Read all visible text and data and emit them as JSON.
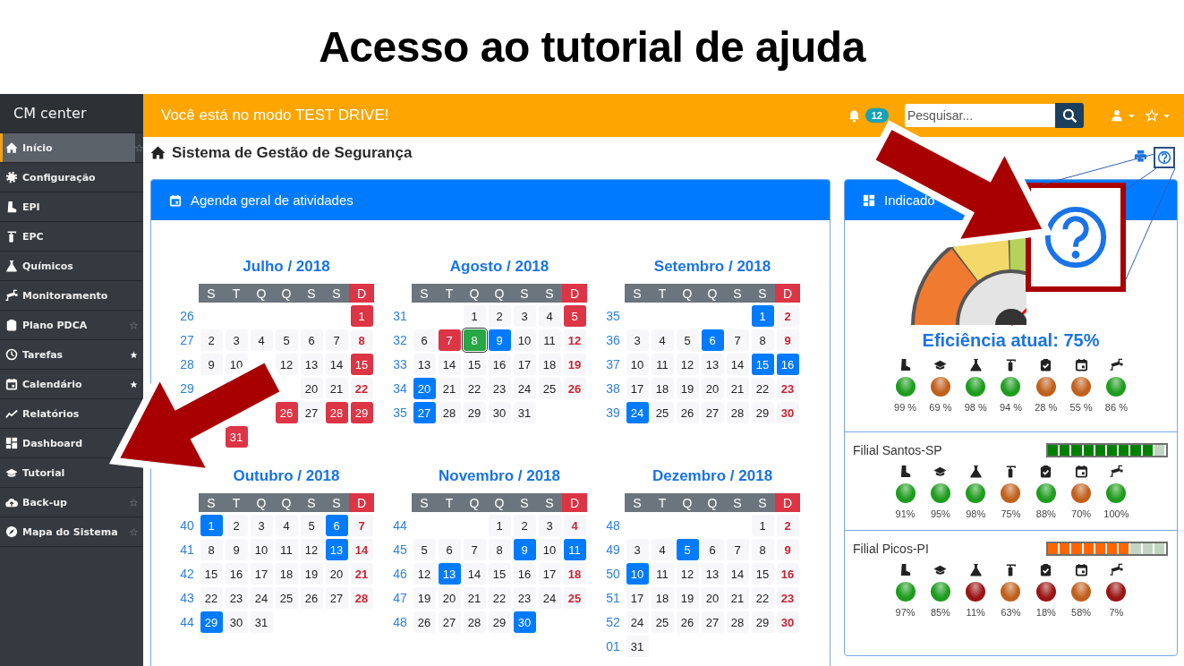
{
  "slide_title": "Acesso ao tutorial de ajuda",
  "sidebar": {
    "brand": "CM center",
    "items": [
      {
        "label": "Início",
        "selected": true,
        "starred": false
      },
      {
        "label": "Configuração",
        "selected": false
      },
      {
        "label": "EPI",
        "selected": false
      },
      {
        "label": "EPC",
        "selected": false
      },
      {
        "label": "Químicos",
        "selected": false
      },
      {
        "label": "Monitoramento",
        "selected": false
      },
      {
        "label": "Plano PDCA",
        "selected": false,
        "starred": false
      },
      {
        "label": "Tarefas",
        "selected": false,
        "starred": true
      },
      {
        "label": "Calendário",
        "selected": false,
        "starred": true
      },
      {
        "label": "Relatórios",
        "selected": false
      },
      {
        "label": "Dashboard",
        "selected": false
      },
      {
        "label": "Tutorial",
        "selected": false
      },
      {
        "label": "Back-up",
        "selected": false,
        "starred": false
      },
      {
        "label": "Mapa do Sistema",
        "selected": false,
        "starred": false
      }
    ]
  },
  "topbar": {
    "message": "Você está no modo TEST DRIVE!",
    "notifications": "12",
    "search": {
      "placeholder": "Pesquisar..."
    }
  },
  "page": {
    "title": "Sistema de Gestão de Segurança"
  },
  "agenda": {
    "title": "Agenda geral de atividades",
    "months": [
      {
        "title": "Julho / 2018",
        "weekdays": [
          "S",
          "T",
          "Q",
          "Q",
          "S",
          "S",
          "D"
        ],
        "weeks": [
          {
            "number": "26",
            "days": [
              {
                "kind": "blank"
              },
              {
                "kind": "blank"
              },
              {
                "kind": "blank"
              },
              {
                "kind": "blank"
              },
              {
                "kind": "blank"
              },
              {
                "kind": "blank"
              },
              {
                "day": "1",
                "kind": "event",
                "color": "#dc3545"
              }
            ]
          },
          {
            "number": "27",
            "days": [
              {
                "day": "2",
                "kind": "plain"
              },
              {
                "day": "3",
                "kind": "plain"
              },
              {
                "day": "4",
                "kind": "plain"
              },
              {
                "day": "5",
                "kind": "plain"
              },
              {
                "day": "6",
                "kind": "plain"
              },
              {
                "day": "7",
                "kind": "plain"
              },
              {
                "day": "8",
                "kind": "plain"
              }
            ]
          },
          {
            "number": "28",
            "days": [
              {
                "day": "9",
                "kind": "plain"
              },
              {
                "day": "10",
                "kind": "plain"
              },
              {
                "kind": "blank"
              },
              {
                "day": "12",
                "kind": "plain"
              },
              {
                "day": "13",
                "kind": "plain"
              },
              {
                "day": "14",
                "kind": "plain"
              },
              {
                "day": "15",
                "kind": "event",
                "color": "#dc3545"
              }
            ]
          },
          {
            "number": "29",
            "days": [
              {
                "kind": "blank"
              },
              {
                "kind": "blank"
              },
              {
                "kind": "blank"
              },
              {
                "kind": "blank"
              },
              {
                "day": "20",
                "kind": "plain"
              },
              {
                "day": "21",
                "kind": "plain"
              },
              {
                "day": "22",
                "kind": "plain"
              }
            ]
          },
          {
            "days": [
              {
                "kind": "blank"
              },
              {
                "kind": "blank"
              },
              {
                "kind": "blank"
              },
              {
                "day": "26",
                "kind": "event",
                "color": "#dc3545"
              },
              {
                "day": "27",
                "kind": "plain"
              },
              {
                "day": "28",
                "kind": "event",
                "color": "#dc3545"
              },
              {
                "day": "29",
                "kind": "event",
                "color": "#dc3545"
              }
            ]
          },
          {
            "days": [
              {
                "kind": "blank"
              },
              {
                "day": "31",
                "kind": "event",
                "color": "#dc3545"
              }
            ]
          }
        ]
      },
      {
        "title": "Agosto / 2018",
        "weekdays": [
          "S",
          "T",
          "Q",
          "Q",
          "S",
          "S",
          "D"
        ],
        "weeks": [
          {
            "number": "31",
            "days": [
              {
                "kind": "blank"
              },
              {
                "kind": "blank"
              },
              {
                "day": "1",
                "kind": "plain"
              },
              {
                "day": "2",
                "kind": "plain"
              },
              {
                "day": "3",
                "kind": "plain"
              },
              {
                "day": "4",
                "kind": "plain"
              },
              {
                "day": "5",
                "kind": "event",
                "color": "#dc3545"
              }
            ]
          },
          {
            "number": "32",
            "days": [
              {
                "day": "6",
                "kind": "plain"
              },
              {
                "day": "7",
                "kind": "event",
                "color": "#dc3545"
              },
              {
                "day": "8",
                "kind": "today",
                "color": "#28a745"
              },
              {
                "day": "9",
                "kind": "event",
                "color": "#007bff"
              },
              {
                "day": "10",
                "kind": "plain"
              },
              {
                "day": "11",
                "kind": "plain"
              },
              {
                "day": "12",
                "kind": "plain"
              }
            ]
          },
          {
            "number": "33",
            "days": [
              {
                "day": "13",
                "kind": "plain"
              },
              {
                "day": "14",
                "kind": "plain"
              },
              {
                "day": "15",
                "kind": "plain"
              },
              {
                "day": "16",
                "kind": "plain"
              },
              {
                "day": "17",
                "kind": "plain"
              },
              {
                "day": "18",
                "kind": "plain"
              },
              {
                "day": "19",
                "kind": "plain"
              }
            ]
          },
          {
            "number": "34",
            "days": [
              {
                "day": "20",
                "kind": "event",
                "color": "#007bff"
              },
              {
                "day": "21",
                "kind": "plain"
              },
              {
                "day": "22",
                "kind": "plain"
              },
              {
                "day": "23",
                "kind": "plain"
              },
              {
                "day": "24",
                "kind": "plain"
              },
              {
                "day": "25",
                "kind": "plain"
              },
              {
                "day": "26",
                "kind": "plain"
              }
            ]
          },
          {
            "number": "35",
            "days": [
              {
                "day": "27",
                "kind": "event",
                "color": "#007bff"
              },
              {
                "day": "28",
                "kind": "plain"
              },
              {
                "day": "29",
                "kind": "plain"
              },
              {
                "day": "30",
                "kind": "plain"
              },
              {
                "day": "31",
                "kind": "plain"
              }
            ]
          }
        ]
      },
      {
        "title": "Setembro / 2018",
        "weekdays": [
          "S",
          "T",
          "Q",
          "Q",
          "S",
          "S",
          "D"
        ],
        "weeks": [
          {
            "number": "35",
            "days": [
              {
                "kind": "blank"
              },
              {
                "kind": "blank"
              },
              {
                "kind": "blank"
              },
              {
                "kind": "blank"
              },
              {
                "kind": "blank"
              },
              {
                "day": "1",
                "kind": "event",
                "color": "#007bff"
              },
              {
                "day": "2",
                "kind": "plain"
              }
            ]
          },
          {
            "number": "36",
            "days": [
              {
                "day": "3",
                "kind": "plain"
              },
              {
                "day": "4",
                "kind": "plain"
              },
              {
                "day": "5",
                "kind": "plain"
              },
              {
                "day": "6",
                "kind": "event",
                "color": "#007bff"
              },
              {
                "day": "7",
                "kind": "plain"
              },
              {
                "day": "8",
                "kind": "plain"
              },
              {
                "day": "9",
                "kind": "plain"
              }
            ]
          },
          {
            "number": "37",
            "days": [
              {
                "day": "10",
                "kind": "plain"
              },
              {
                "day": "11",
                "kind": "plain"
              },
              {
                "day": "12",
                "kind": "plain"
              },
              {
                "day": "13",
                "kind": "plain"
              },
              {
                "day": "14",
                "kind": "plain"
              },
              {
                "day": "15",
                "kind": "event",
                "color": "#007bff"
              },
              {
                "day": "16",
                "kind": "event",
                "color": "#007bff"
              }
            ]
          },
          {
            "number": "38",
            "days": [
              {
                "day": "17",
                "kind": "plain"
              },
              {
                "day": "18",
                "kind": "plain"
              },
              {
                "day": "19",
                "kind": "plain"
              },
              {
                "day": "20",
                "kind": "plain"
              },
              {
                "day": "21",
                "kind": "plain"
              },
              {
                "day": "22",
                "kind": "plain"
              },
              {
                "day": "23",
                "kind": "plain"
              }
            ]
          },
          {
            "number": "39",
            "days": [
              {
                "day": "24",
                "kind": "event",
                "color": "#007bff"
              },
              {
                "day": "25",
                "kind": "plain"
              },
              {
                "day": "26",
                "kind": "plain"
              },
              {
                "day": "27",
                "kind": "plain"
              },
              {
                "day": "28",
                "kind": "plain"
              },
              {
                "day": "29",
                "kind": "plain"
              },
              {
                "day": "30",
                "kind": "plain"
              }
            ]
          }
        ]
      },
      {
        "title": "Outubro / 2018",
        "weekdays": [
          "S",
          "T",
          "Q",
          "Q",
          "S",
          "S",
          "D"
        ],
        "weeks": [
          {
            "number": "40",
            "days": [
              {
                "day": "1",
                "kind": "event",
                "color": "#007bff"
              },
              {
                "day": "2",
                "kind": "plain"
              },
              {
                "day": "3",
                "kind": "plain"
              },
              {
                "day": "4",
                "kind": "plain"
              },
              {
                "day": "5",
                "kind": "plain"
              },
              {
                "day": "6",
                "kind": "event",
                "color": "#007bff"
              },
              {
                "day": "7",
                "kind": "plain"
              }
            ]
          },
          {
            "number": "41",
            "days": [
              {
                "day": "8",
                "kind": "plain"
              },
              {
                "day": "9",
                "kind": "plain"
              },
              {
                "day": "10",
                "kind": "plain"
              },
              {
                "day": "11",
                "kind": "plain"
              },
              {
                "day": "12",
                "kind": "plain"
              },
              {
                "day": "13",
                "kind": "event",
                "color": "#007bff"
              },
              {
                "day": "14",
                "kind": "plain"
              }
            ]
          },
          {
            "number": "42",
            "days": [
              {
                "day": "15",
                "kind": "plain"
              },
              {
                "day": "16",
                "kind": "plain"
              },
              {
                "day": "17",
                "kind": "plain"
              },
              {
                "day": "18",
                "kind": "plain"
              },
              {
                "day": "19",
                "kind": "plain"
              },
              {
                "day": "20",
                "kind": "plain"
              },
              {
                "day": "21",
                "kind": "plain"
              }
            ]
          },
          {
            "number": "43",
            "days": [
              {
                "day": "22",
                "kind": "plain"
              },
              {
                "day": "23",
                "kind": "plain"
              },
              {
                "day": "24",
                "kind": "plain"
              },
              {
                "day": "25",
                "kind": "plain"
              },
              {
                "day": "26",
                "kind": "plain"
              },
              {
                "day": "27",
                "kind": "plain"
              },
              {
                "day": "28",
                "kind": "plain"
              }
            ]
          },
          {
            "number": "44",
            "days": [
              {
                "day": "29",
                "kind": "event",
                "color": "#007bff"
              },
              {
                "day": "30",
                "kind": "plain"
              },
              {
                "day": "31",
                "kind": "plain"
              }
            ]
          }
        ]
      },
      {
        "title": "Novembro / 2018",
        "weekdays": [
          "S",
          "T",
          "Q",
          "Q",
          "S",
          "S",
          "D"
        ],
        "weeks": [
          {
            "number": "44",
            "days": [
              {
                "kind": "blank"
              },
              {
                "kind": "blank"
              },
              {
                "kind": "blank"
              },
              {
                "day": "1",
                "kind": "plain"
              },
              {
                "day": "2",
                "kind": "plain"
              },
              {
                "day": "3",
                "kind": "plain"
              },
              {
                "day": "4",
                "kind": "plain"
              }
            ]
          },
          {
            "number": "45",
            "days": [
              {
                "day": "5",
                "kind": "plain"
              },
              {
                "day": "6",
                "kind": "plain"
              },
              {
                "day": "7",
                "kind": "plain"
              },
              {
                "day": "8",
                "kind": "plain"
              },
              {
                "day": "9",
                "kind": "event",
                "color": "#007bff"
              },
              {
                "day": "10",
                "kind": "plain"
              },
              {
                "day": "11",
                "kind": "event",
                "color": "#007bff"
              }
            ]
          },
          {
            "number": "46",
            "days": [
              {
                "day": "12",
                "kind": "plain"
              },
              {
                "day": "13",
                "kind": "event",
                "color": "#007bff"
              },
              {
                "day": "14",
                "kind": "plain"
              },
              {
                "day": "15",
                "kind": "plain"
              },
              {
                "day": "16",
                "kind": "plain"
              },
              {
                "day": "17",
                "kind": "plain"
              },
              {
                "day": "18",
                "kind": "plain"
              }
            ]
          },
          {
            "number": "47",
            "days": [
              {
                "day": "19",
                "kind": "plain"
              },
              {
                "day": "20",
                "kind": "plain"
              },
              {
                "day": "21",
                "kind": "plain"
              },
              {
                "day": "22",
                "kind": "plain"
              },
              {
                "day": "23",
                "kind": "plain"
              },
              {
                "day": "24",
                "kind": "plain"
              },
              {
                "day": "25",
                "kind": "plain"
              }
            ]
          },
          {
            "number": "48",
            "days": [
              {
                "day": "26",
                "kind": "plain"
              },
              {
                "day": "27",
                "kind": "plain"
              },
              {
                "day": "28",
                "kind": "plain"
              },
              {
                "day": "29",
                "kind": "plain"
              },
              {
                "day": "30",
                "kind": "event",
                "color": "#007bff"
              }
            ]
          }
        ]
      },
      {
        "title": "Dezembro / 2018",
        "weekdays": [
          "S",
          "T",
          "Q",
          "Q",
          "S",
          "S",
          "D"
        ],
        "weeks": [
          {
            "number": "48",
            "days": [
              {
                "kind": "blank"
              },
              {
                "kind": "blank"
              },
              {
                "kind": "blank"
              },
              {
                "kind": "blank"
              },
              {
                "kind": "blank"
              },
              {
                "day": "1",
                "kind": "plain"
              },
              {
                "day": "2",
                "kind": "plain"
              }
            ]
          },
          {
            "number": "49",
            "days": [
              {
                "day": "3",
                "kind": "plain"
              },
              {
                "day": "4",
                "kind": "plain"
              },
              {
                "day": "5",
                "kind": "event",
                "color": "#007bff"
              },
              {
                "day": "6",
                "kind": "plain"
              },
              {
                "day": "7",
                "kind": "plain"
              },
              {
                "day": "8",
                "kind": "plain"
              },
              {
                "day": "9",
                "kind": "plain"
              }
            ]
          },
          {
            "number": "50",
            "days": [
              {
                "day": "10",
                "kind": "event",
                "color": "#007bff"
              },
              {
                "day": "11",
                "kind": "plain"
              },
              {
                "day": "12",
                "kind": "plain"
              },
              {
                "day": "13",
                "kind": "plain"
              },
              {
                "day": "14",
                "kind": "plain"
              },
              {
                "day": "15",
                "kind": "plain"
              },
              {
                "day": "16",
                "kind": "plain"
              }
            ]
          },
          {
            "number": "51",
            "days": [
              {
                "day": "17",
                "kind": "plain"
              },
              {
                "day": "18",
                "kind": "plain"
              },
              {
                "day": "19",
                "kind": "plain"
              },
              {
                "day": "20",
                "kind": "plain"
              },
              {
                "day": "21",
                "kind": "plain"
              },
              {
                "day": "22",
                "kind": "plain"
              },
              {
                "day": "23",
                "kind": "plain"
              }
            ]
          },
          {
            "number": "52",
            "days": [
              {
                "day": "24",
                "kind": "plain"
              },
              {
                "day": "25",
                "kind": "plain"
              },
              {
                "day": "26",
                "kind": "plain"
              },
              {
                "day": "27",
                "kind": "plain"
              },
              {
                "day": "28",
                "kind": "plain"
              },
              {
                "day": "29",
                "kind": "plain"
              },
              {
                "day": "30",
                "kind": "plain"
              }
            ]
          },
          {
            "number": "01",
            "days": [
              {
                "day": "31",
                "kind": "plain"
              }
            ]
          }
        ]
      }
    ]
  },
  "indicators": {
    "title": "Indicado",
    "summary": "Eficiência atual: 75%",
    "metrics": [
      {
        "color": "#1e9c1e",
        "value": "99 %"
      },
      {
        "color": "#c0601c",
        "value": "69 %"
      },
      {
        "color": "#1e9c1e",
        "value": "98 %"
      },
      {
        "color": "#1e9c1e",
        "value": "94 %"
      },
      {
        "color": "#c0601c",
        "value": "28 %"
      },
      {
        "color": "#c0601c",
        "value": "55 %"
      },
      {
        "color": "#1e9c1e",
        "value": "86 %"
      }
    ],
    "branches": [
      {
        "name": "Filial Santos-SP",
        "level": 0.9,
        "color": "#008000",
        "metrics": [
          {
            "color": "#1e9c1e",
            "value": "91%"
          },
          {
            "color": "#1e9c1e",
            "value": "95%"
          },
          {
            "color": "#1e9c1e",
            "value": "98%"
          },
          {
            "color": "#c0601c",
            "value": "75%"
          },
          {
            "color": "#1e9c1e",
            "value": "88%"
          },
          {
            "color": "#c0601c",
            "value": "70%"
          },
          {
            "color": "#1e9c1e",
            "value": "100%"
          }
        ]
      },
      {
        "name": "Filial Picos-PI",
        "level": 0.7,
        "color": "#ff6600",
        "metrics": [
          {
            "color": "#1e9c1e",
            "value": "97%"
          },
          {
            "color": "#1e9c1e",
            "value": "85%"
          },
          {
            "color": "#9b1414",
            "value": "11%"
          },
          {
            "color": "#c0601c",
            "value": "63%"
          },
          {
            "color": "#9b1414",
            "value": "18%"
          },
          {
            "color": "#c0601c",
            "value": "58%"
          },
          {
            "color": "#9b1414",
            "value": "7%"
          }
        ]
      }
    ]
  }
}
